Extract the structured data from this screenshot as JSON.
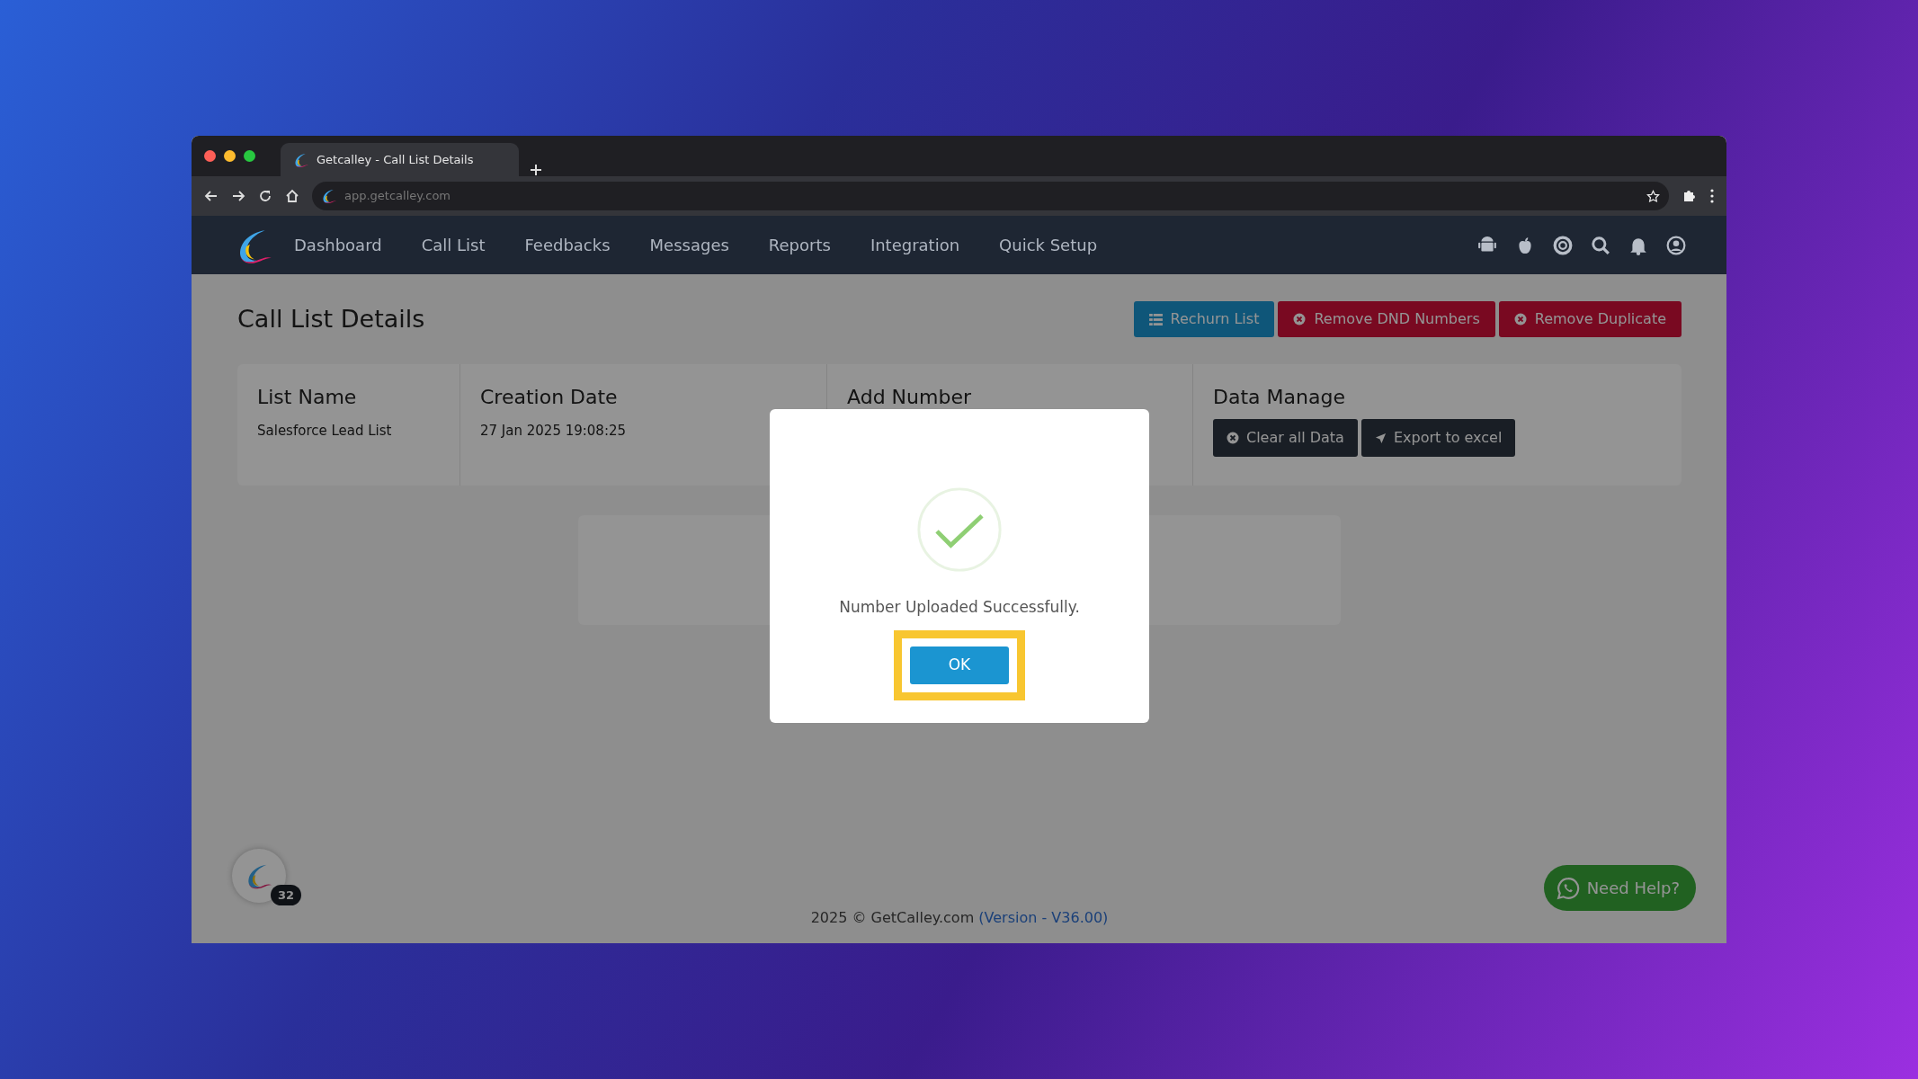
{
  "browser": {
    "tab_title": "Getcalley - Call List Details",
    "url": "app.getcalley.com"
  },
  "nav": {
    "items": [
      {
        "label": "Dashboard"
      },
      {
        "label": "Call List"
      },
      {
        "label": "Feedbacks"
      },
      {
        "label": "Messages"
      },
      {
        "label": "Reports"
      },
      {
        "label": "Integration"
      },
      {
        "label": "Quick Setup"
      }
    ]
  },
  "page": {
    "title": "Call List Details",
    "actions": [
      {
        "label": "Rechurn List",
        "kind": "list"
      },
      {
        "label": "Remove DND Numbers",
        "kind": "remove"
      },
      {
        "label": "Remove Duplicate",
        "kind": "remove"
      }
    ],
    "details": [
      {
        "kind": "text",
        "heading": "List Name",
        "value": "Salesforce Lead List"
      },
      {
        "kind": "text",
        "heading": "Creation Date",
        "value": "27 Jan 2025 19:08:25"
      },
      {
        "kind": "empty",
        "heading": "Add Number"
      },
      {
        "kind": "buttons",
        "heading": "Data Manage",
        "buttons": [
          {
            "label": "Clear all Data",
            "kind": "clear"
          },
          {
            "label": "Export to excel",
            "kind": "export"
          }
        ]
      }
    ]
  },
  "modal": {
    "message": "Number Uploaded Successfully.",
    "button": "OK",
    "highlighted": true
  },
  "chat_widget": {
    "badge": "32"
  },
  "footer": {
    "copyright": "2025 © GetCalley.com",
    "version_link": "(Version - V36.00)"
  },
  "help_button": {
    "label": "Need Help?"
  }
}
